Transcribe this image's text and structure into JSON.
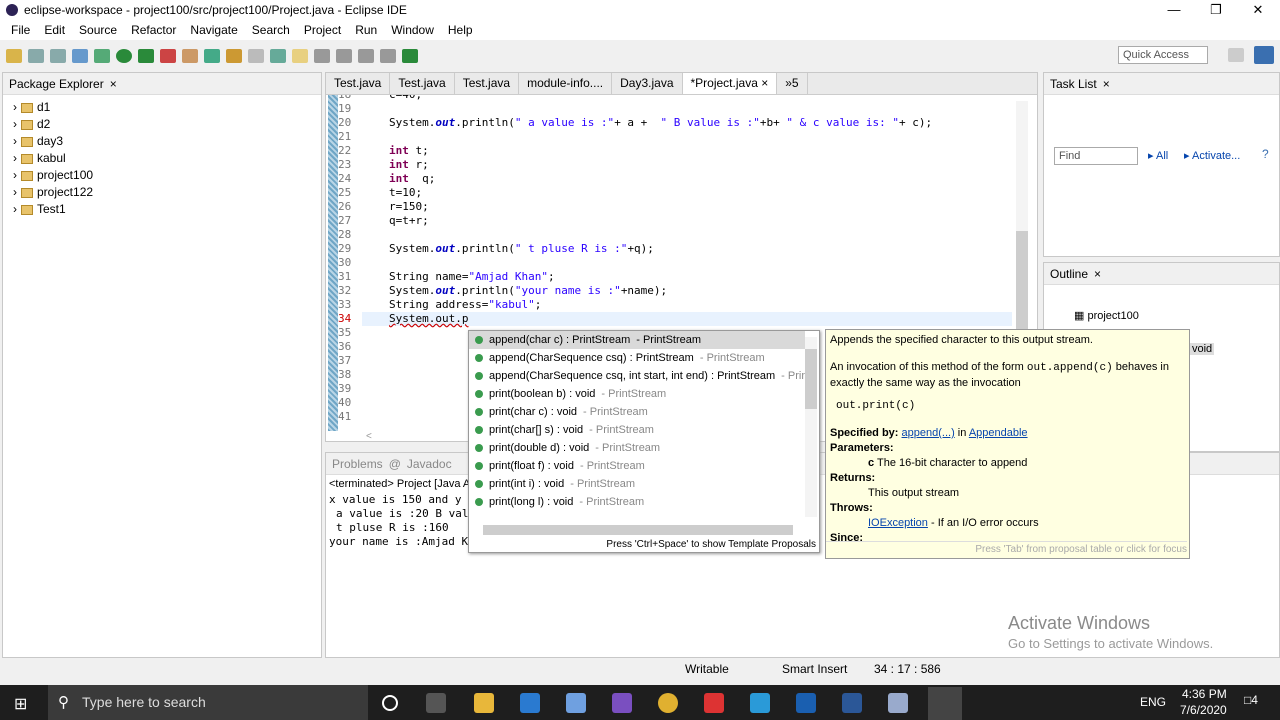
{
  "window": {
    "title": "eclipse-workspace - project100/src/project100/Project.java - Eclipse IDE"
  },
  "menu": [
    "File",
    "Edit",
    "Source",
    "Refactor",
    "Navigate",
    "Search",
    "Project",
    "Run",
    "Window",
    "Help"
  ],
  "quick_access": "Quick Access",
  "package_explorer": {
    "title": "Package Explorer",
    "items": [
      "d1",
      "d2",
      "day3",
      "kabul",
      "project100",
      "project122",
      "Test1"
    ]
  },
  "editor": {
    "tabs": [
      "Test.java",
      "Test.java",
      "Test.java",
      "module-info....",
      "Day3.java",
      "*Project.java"
    ],
    "overflow": "5",
    "lines": [
      {
        "n": "18",
        "code": "c=40;"
      },
      {
        "n": "19",
        "code": ""
      },
      {
        "n": "20",
        "code": "System.out.println(\" a value is :\"+ a +  \" B value is :\"+b+ \" & c value is: \"+ c);"
      },
      {
        "n": "21",
        "code": ""
      },
      {
        "n": "22",
        "code": "int t;"
      },
      {
        "n": "23",
        "code": "int r;"
      },
      {
        "n": "24",
        "code": "int  q;"
      },
      {
        "n": "25",
        "code": "t=10;"
      },
      {
        "n": "26",
        "code": "r=150;"
      },
      {
        "n": "27",
        "code": "q=t+r;"
      },
      {
        "n": "28",
        "code": ""
      },
      {
        "n": "29",
        "code": "System.out.println(\" t pluse R is :\"+q);"
      },
      {
        "n": "30",
        "code": ""
      },
      {
        "n": "31",
        "code": "String name=\"Amjad Khan\";"
      },
      {
        "n": "32",
        "code": "System.out.println(\"your name is :\"+name);"
      },
      {
        "n": "33",
        "code": "String address=\"kabul\";"
      },
      {
        "n": "34",
        "code": "System.out.p"
      },
      {
        "n": "35",
        "code": ""
      },
      {
        "n": "36",
        "code": ""
      },
      {
        "n": "37",
        "code": ""
      },
      {
        "n": "38",
        "code": ""
      },
      {
        "n": "39",
        "code": ""
      },
      {
        "n": "40",
        "code": ""
      },
      {
        "n": "41",
        "code": ""
      }
    ]
  },
  "completion": {
    "items": [
      {
        "sig": "append(char c) : PrintStream",
        "owner": "PrintStream"
      },
      {
        "sig": "append(CharSequence csq) : PrintStream",
        "owner": "PrintStream"
      },
      {
        "sig": "append(CharSequence csq, int start, int end) : PrintStream",
        "owner": "Prin"
      },
      {
        "sig": "print(boolean b) : void",
        "owner": "PrintStream"
      },
      {
        "sig": "print(char c) : void",
        "owner": "PrintStream"
      },
      {
        "sig": "print(char[] s) : void",
        "owner": "PrintStream"
      },
      {
        "sig": "print(double d) : void",
        "owner": "PrintStream"
      },
      {
        "sig": "print(float f) : void",
        "owner": "PrintStream"
      },
      {
        "sig": "print(int i) : void",
        "owner": "PrintStream"
      },
      {
        "sig": "print(long l) : void",
        "owner": "PrintStream"
      }
    ],
    "footer": "Press 'Ctrl+Space' to show Template Proposals"
  },
  "javadoc": {
    "summary": "Appends the specified character to this output stream.",
    "desc1": "An invocation of this method of the form ",
    "desc_code": "out.append(c)",
    "desc2": " behaves in exactly the same way as the invocation",
    "example": "out.print(c)",
    "specified_label": "Specified by:",
    "specified_link": "append(...)",
    "in": "in",
    "specified_iface": "Appendable",
    "params_label": "Parameters:",
    "param_name": "c",
    "param_desc": "The 16-bit character to append",
    "returns_label": "Returns:",
    "returns_desc": "This output stream",
    "throws_label": "Throws:",
    "throws_link": "IOException",
    "throws_desc": "- If an I/O error occurs",
    "since_label": "Since:",
    "footer": "Press 'Tab' from proposal table or click for focus"
  },
  "task_list": {
    "title": "Task List",
    "find_placeholder": "Find",
    "all": "All",
    "activate": "Activate..."
  },
  "outline": {
    "title": "Outline",
    "item": "project100",
    "partial": "void"
  },
  "console": {
    "tabs": [
      "Problems",
      "Javadoc"
    ],
    "header": "<terminated> Project [Java A",
    "lines": [
      "x value is 150 and y",
      "a value is :20 B val",
      "t pluse R is :160",
      "your name is :Amjad K"
    ]
  },
  "watermark": {
    "title": "Activate Windows",
    "sub": "Go to Settings to activate Windows."
  },
  "status": {
    "writable": "Writable",
    "insert": "Smart Insert",
    "position": "34 : 17 : 586"
  },
  "taskbar": {
    "search": "Type here to search",
    "time": "4:36 PM",
    "date": "7/6/2020",
    "lang": "ENG",
    "notif": "4"
  }
}
